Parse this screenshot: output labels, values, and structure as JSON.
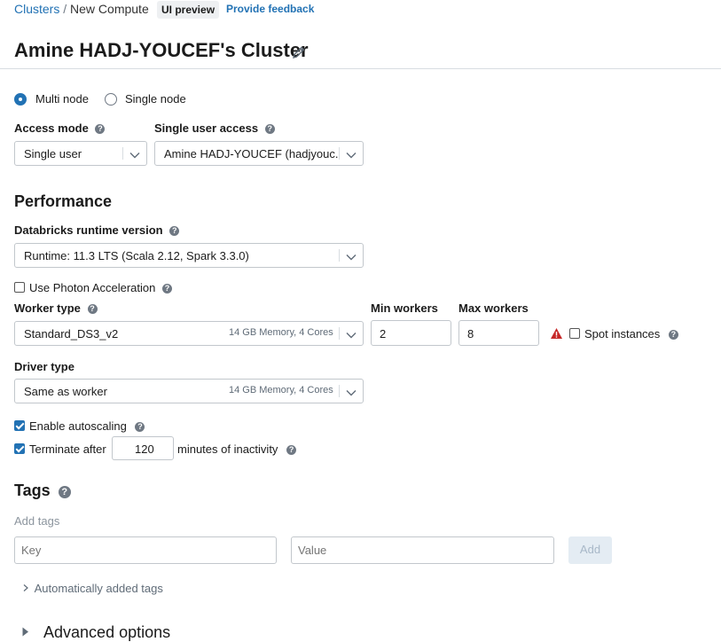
{
  "breadcrumb": {
    "root": "Clusters",
    "separator": "/",
    "current": "New Compute"
  },
  "badges": {
    "ui_preview": "UI preview",
    "feedback": "Provide feedback"
  },
  "page_title": "Amine HADJ-YOUCEF's Cluster",
  "node_mode": {
    "multi": "Multi node",
    "single": "Single node",
    "selected": "multi"
  },
  "access_mode": {
    "label": "Access mode",
    "value": "Single user"
  },
  "single_user_access": {
    "label": "Single user access",
    "value": "Amine HADJ-YOUCEF (hadjyouc..."
  },
  "performance": {
    "title": "Performance",
    "runtime_label": "Databricks runtime version",
    "runtime_value": "Runtime: 11.3 LTS (Scala 2.12, Spark 3.3.0)",
    "photon_label": "Use Photon Acceleration",
    "photon_checked": false,
    "worker_type_label": "Worker type",
    "worker_type_value": "Standard_DS3_v2",
    "worker_type_meta": "14 GB Memory, 4 Cores",
    "min_workers_label": "Min workers",
    "min_workers_value": "2",
    "max_workers_label": "Max workers",
    "max_workers_value": "8",
    "spot_label": "Spot instances",
    "spot_checked": false,
    "driver_type_label": "Driver type",
    "driver_type_value": "Same as worker",
    "driver_type_meta": "14 GB Memory, 4 Cores",
    "autoscaling_label": "Enable autoscaling",
    "autoscaling_checked": true,
    "terminate_label": "Terminate after",
    "terminate_value": "120",
    "terminate_suffix": "minutes of inactivity",
    "terminate_checked": true
  },
  "tags": {
    "title": "Tags",
    "subtitle": "Add tags",
    "key_placeholder": "Key",
    "value_placeholder": "Value",
    "add_label": "Add",
    "auto_added": "Automatically added tags"
  },
  "advanced": {
    "label": "Advanced options"
  },
  "colors": {
    "accent": "#2272b4",
    "warning": "#c62828",
    "text": "#1b1b1b",
    "muted": "#8c959e",
    "border": "#c2c7cc"
  }
}
